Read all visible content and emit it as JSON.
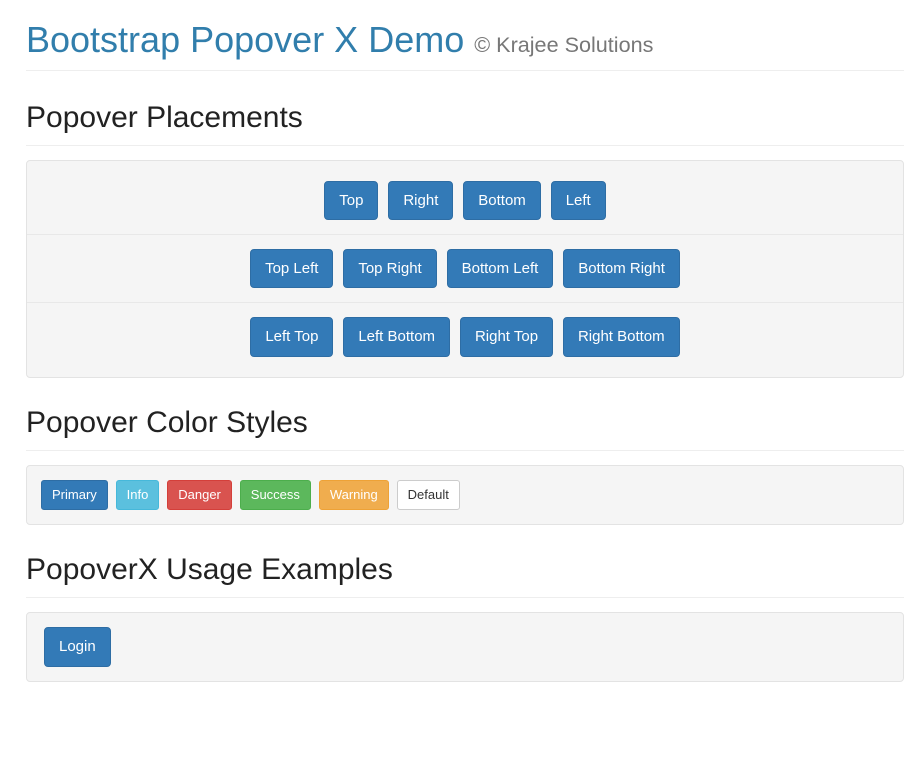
{
  "header": {
    "title": "Bootstrap Popover X Demo",
    "copyright": "© Krajee Solutions"
  },
  "sections": {
    "placements_title": "Popover Placements",
    "styles_title": "Popover Color Styles",
    "usage_title": "PopoverX Usage Examples"
  },
  "placements": {
    "row1": {
      "top": "Top",
      "right": "Right",
      "bottom": "Bottom",
      "left": "Left"
    },
    "row2": {
      "top_left": "Top Left",
      "top_right": "Top Right",
      "bottom_left": "Bottom Left",
      "bottom_right": "Bottom Right"
    },
    "row3": {
      "left_top": "Left Top",
      "left_bottom": "Left Bottom",
      "right_top": "Right Top",
      "right_bottom": "Right Bottom"
    }
  },
  "styles": {
    "primary": "Primary",
    "info": "Info",
    "danger": "Danger",
    "success": "Success",
    "warning": "Warning",
    "default": "Default"
  },
  "usage": {
    "login": "Login"
  }
}
